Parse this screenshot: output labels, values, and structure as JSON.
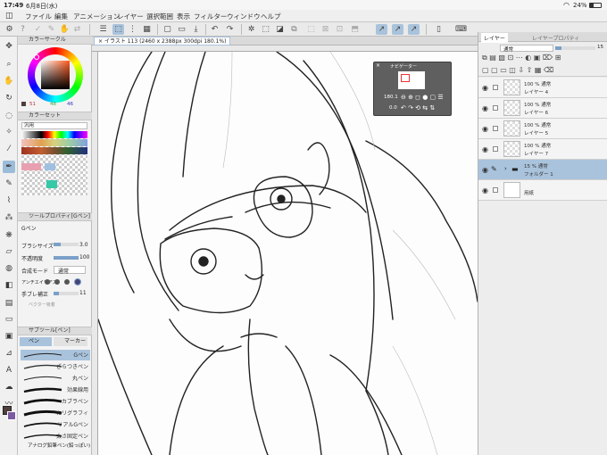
{
  "status_bar": {
    "time": "17:49",
    "date": "6月8日(水)",
    "battery": "24%"
  },
  "menu": [
    "ファイル",
    "編集",
    "アニメーション",
    "レイヤー",
    "選択範囲",
    "表示",
    "フィルター",
    "ウィンドウ",
    "ヘルプ"
  ],
  "canvas_tab": {
    "title": "イラスト 113 (2460 x 2388px 300dpi 180.1%)"
  },
  "navigator": {
    "title": "ナビゲーター",
    "zoom": "180.1",
    "angle": "0.0"
  },
  "color_circle": {
    "title": "カラーサークル",
    "values": [
      "51",
      "48",
      "46"
    ],
    "hue_color": "#4f3f3c"
  },
  "color_set": {
    "title": "カラーセット",
    "set_name": "汎用"
  },
  "tool_property": {
    "title": "ツールプロパティ[Gペン]",
    "tool_name": "Gペン",
    "brush_size_label": "ブラシサイズ",
    "brush_size": "3.0",
    "opacity_label": "不透明度",
    "opacity": "100",
    "blend_label": "合成モード",
    "blend": "通常",
    "antialias_label": "アンチエイリアス",
    "stabilize_label": "手ブレ補正",
    "stabilize": "11",
    "vector_label": "ベクター吸着"
  },
  "sub_tool": {
    "title": "サブツール[ペン]",
    "tabs": [
      "ペン",
      "マーカー"
    ],
    "brushes": [
      "Gペン",
      "ざらつきペン",
      "丸ペン",
      "効果線用",
      "カブラペン",
      "カリグラフィ",
      "リアルGペン",
      "太さ固定ペン"
    ],
    "footer": "アナログ鉛筆ペン(鉛っぽい)"
  },
  "layer_panel": {
    "tabs": [
      "レイヤー",
      "レイヤープロパティ"
    ],
    "blend_mode": "通常",
    "opacity_value": "15",
    "layers": [
      {
        "opacity": "100 % 通常",
        "name": "レイヤー 4"
      },
      {
        "opacity": "100 % 通常",
        "name": "レイヤー 6"
      },
      {
        "opacity": "100 % 通常",
        "name": "レイヤー 5"
      },
      {
        "opacity": "100 % 通常",
        "name": "レイヤー 7"
      },
      {
        "opacity": "15 % 通常",
        "name": "フォルダー 1"
      },
      {
        "opacity": "",
        "name": "用紙"
      }
    ]
  },
  "colors": {
    "selection": "#a9c3dc",
    "panel": "#f3f3f3",
    "canvas_bg": "#8a8a8a",
    "navigator": "#5f5f5f"
  }
}
